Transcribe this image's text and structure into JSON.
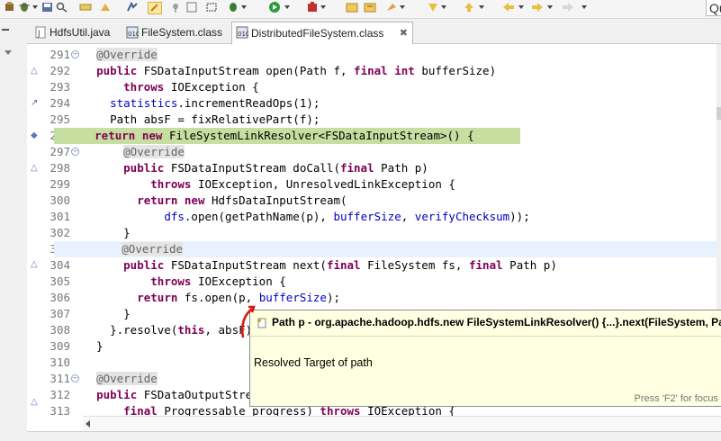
{
  "toolbar": {
    "quick_access_text": "Qu",
    "icons": [
      "build-icon",
      "debug-icon",
      "run-icon",
      "external-tools-icon",
      "new-java-class-icon",
      "open-type-icon",
      "search-icon",
      "annotation-nav-icon",
      "back-icon",
      "forward-icon"
    ]
  },
  "tabs": [
    {
      "label": "HdfsUtil.java",
      "icon": "java-file-icon",
      "active": false
    },
    {
      "label": "FileSystem.class",
      "icon": "class-file-icon",
      "active": false
    },
    {
      "label": "DistributedFileSystem.class",
      "icon": "class-file-icon",
      "active": true,
      "close": "✖"
    }
  ],
  "editor": {
    "line_numbers": [
      "291",
      "292",
      "293",
      "294",
      "295",
      "296",
      "297",
      "298",
      "299",
      "300",
      "301",
      "302",
      "303",
      "304",
      "305",
      "306",
      "307",
      "308",
      "309",
      "310",
      "311",
      "312",
      "313"
    ]
  },
  "popup": {
    "signature": "Path p - org.apache.hadoop.hdfs.new FileSystemLinkResolver() {...}.next(FileSystem, Path)",
    "doc": "Resolved Target of path",
    "status": "Press 'F2' for focus"
  },
  "colors": {
    "keyword": "#7f0055",
    "field": "#0000c0",
    "annotation": "#646464",
    "occurrence_highlight": "#c6dfa0",
    "current_line": "#e8f2fe",
    "popup_bg": "#ffffe1"
  }
}
